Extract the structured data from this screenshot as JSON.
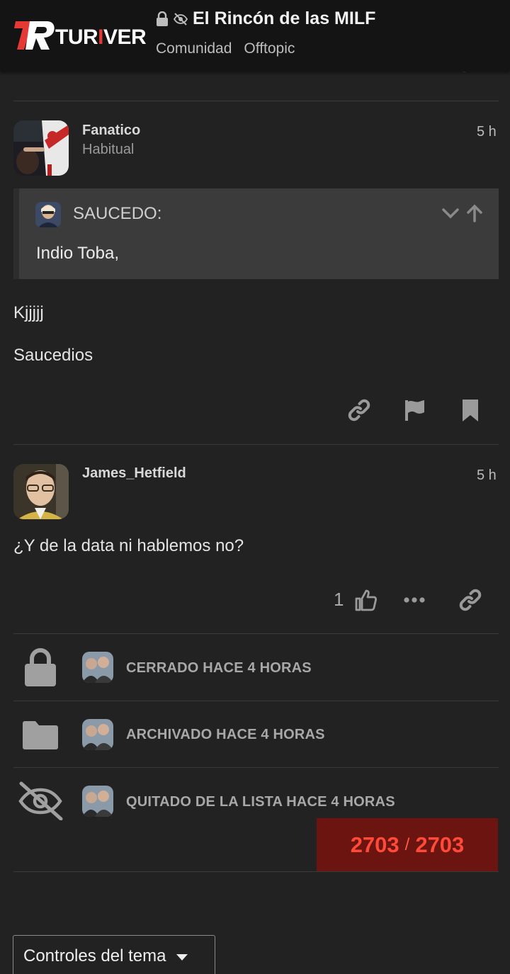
{
  "header": {
    "logo_text_a": "TUR",
    "logo_text_b": "I",
    "logo_text_c": "VER",
    "title": "El Rincón de las MILF",
    "breadcrumbs": [
      "Comunidad",
      "Offtopic"
    ]
  },
  "posts": [
    {
      "username": "Fanatico",
      "user_title": "Habitual",
      "time": "5 h",
      "quote": {
        "author": "SAUCEDO:",
        "text": "Indio Toba,"
      },
      "paragraphs": [
        "Kjjjjj",
        "Saucedios"
      ]
    },
    {
      "username": "James_Hetfield",
      "time": "5 h",
      "paragraphs": [
        "¿Y de la data ni hablemos no?"
      ],
      "likes": "1"
    }
  ],
  "small_actions": [
    {
      "icon": "lock-icon",
      "text": "CERRADO HACE 4 HORAS"
    },
    {
      "icon": "folder-icon",
      "text": "ARCHIVADO HACE 4 HORAS"
    },
    {
      "icon": "eye-slash-icon",
      "text": "QUITADO DE LA LISTA HACE 4 HORAS"
    }
  ],
  "progress": {
    "current": "2703",
    "separator": "/",
    "total": "2703"
  },
  "topic_controls": {
    "label": "Controles del tema"
  },
  "colors": {
    "accent": "#e53935",
    "progress_bg": "#6b1410",
    "progress_text": "#ff4a3a",
    "background": "#222222"
  }
}
